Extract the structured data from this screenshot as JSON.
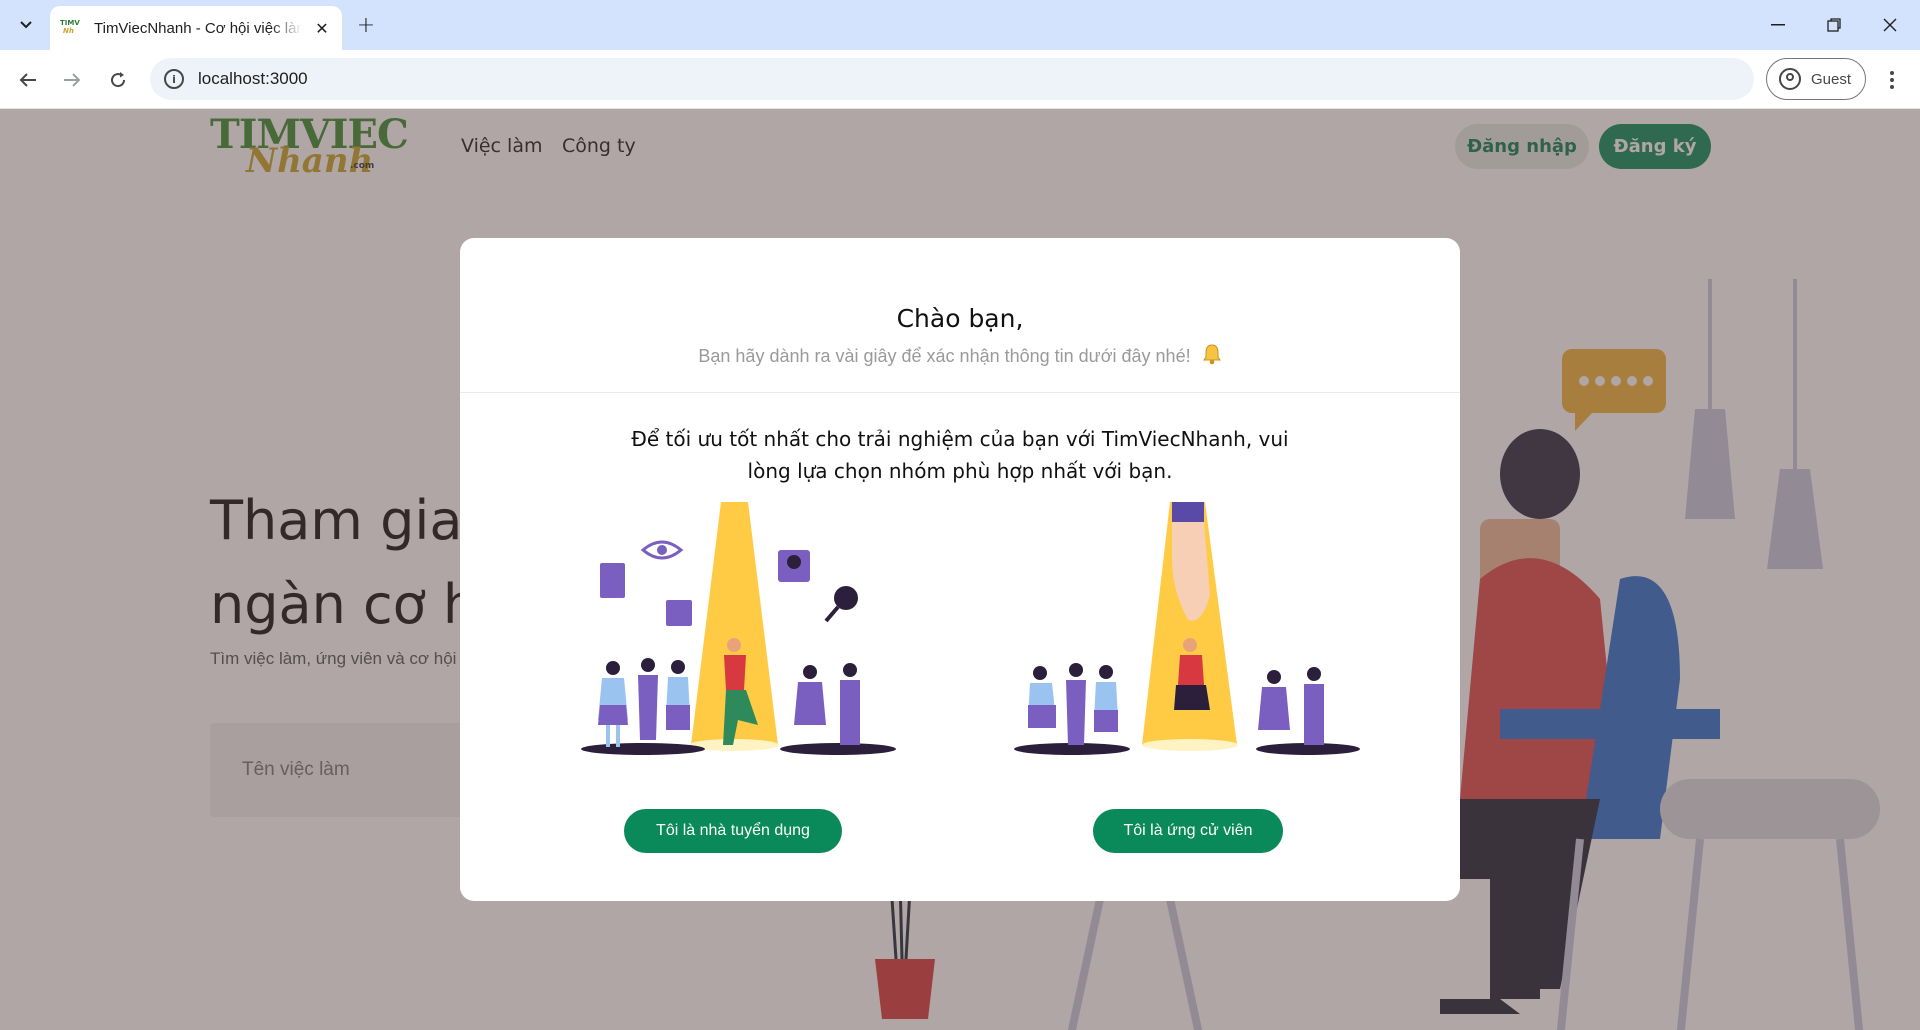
{
  "browser": {
    "tab_title": "TimViecNhanh - Cơ hội việc làm",
    "url": "localhost:3000",
    "profile_label": "Guest"
  },
  "site": {
    "logo_top": "TIMVIEC",
    "logo_bottom": "Nhanh",
    "logo_suffix": ".com",
    "nav": [
      "Việc làm",
      "Công ty"
    ],
    "login_label": "Đăng nhập",
    "register_label": "Đăng ký"
  },
  "hero": {
    "title_line1": "Tham gia",
    "title_line2": "ngàn cơ h",
    "subtitle": "Tìm việc làm, ứng viên và cơ hội",
    "search_placeholder": "Tên việc làm"
  },
  "modal": {
    "title": "Chào bạn,",
    "subtitle": "Bạn hãy dành ra vài giây để xác nhận thông tin dưới đây nhé!",
    "question": "Để tối ưu tốt nhất cho trải nghiệm của bạn với TimViecNhanh, vui lòng lựa chọn nhóm phù hợp nhất với bạn.",
    "employer_button": "Tôi là nhà tuyển dụng",
    "candidate_button": "Tôi là ứng cử viên"
  },
  "colors": {
    "brand_green": "#0a8a5a",
    "overlay": "rgba(88,70,66,0.48)",
    "illustration_purple": "#7b5fc0",
    "spotlight_yellow": "#ffcb45"
  },
  "icons": [
    "tab-search-icon",
    "close-icon",
    "plus-icon",
    "minimize-icon",
    "restore-icon",
    "back-icon",
    "forward-icon",
    "reload-icon",
    "info-icon",
    "guest-avatar-icon",
    "kebab-menu-icon",
    "bell-icon"
  ]
}
